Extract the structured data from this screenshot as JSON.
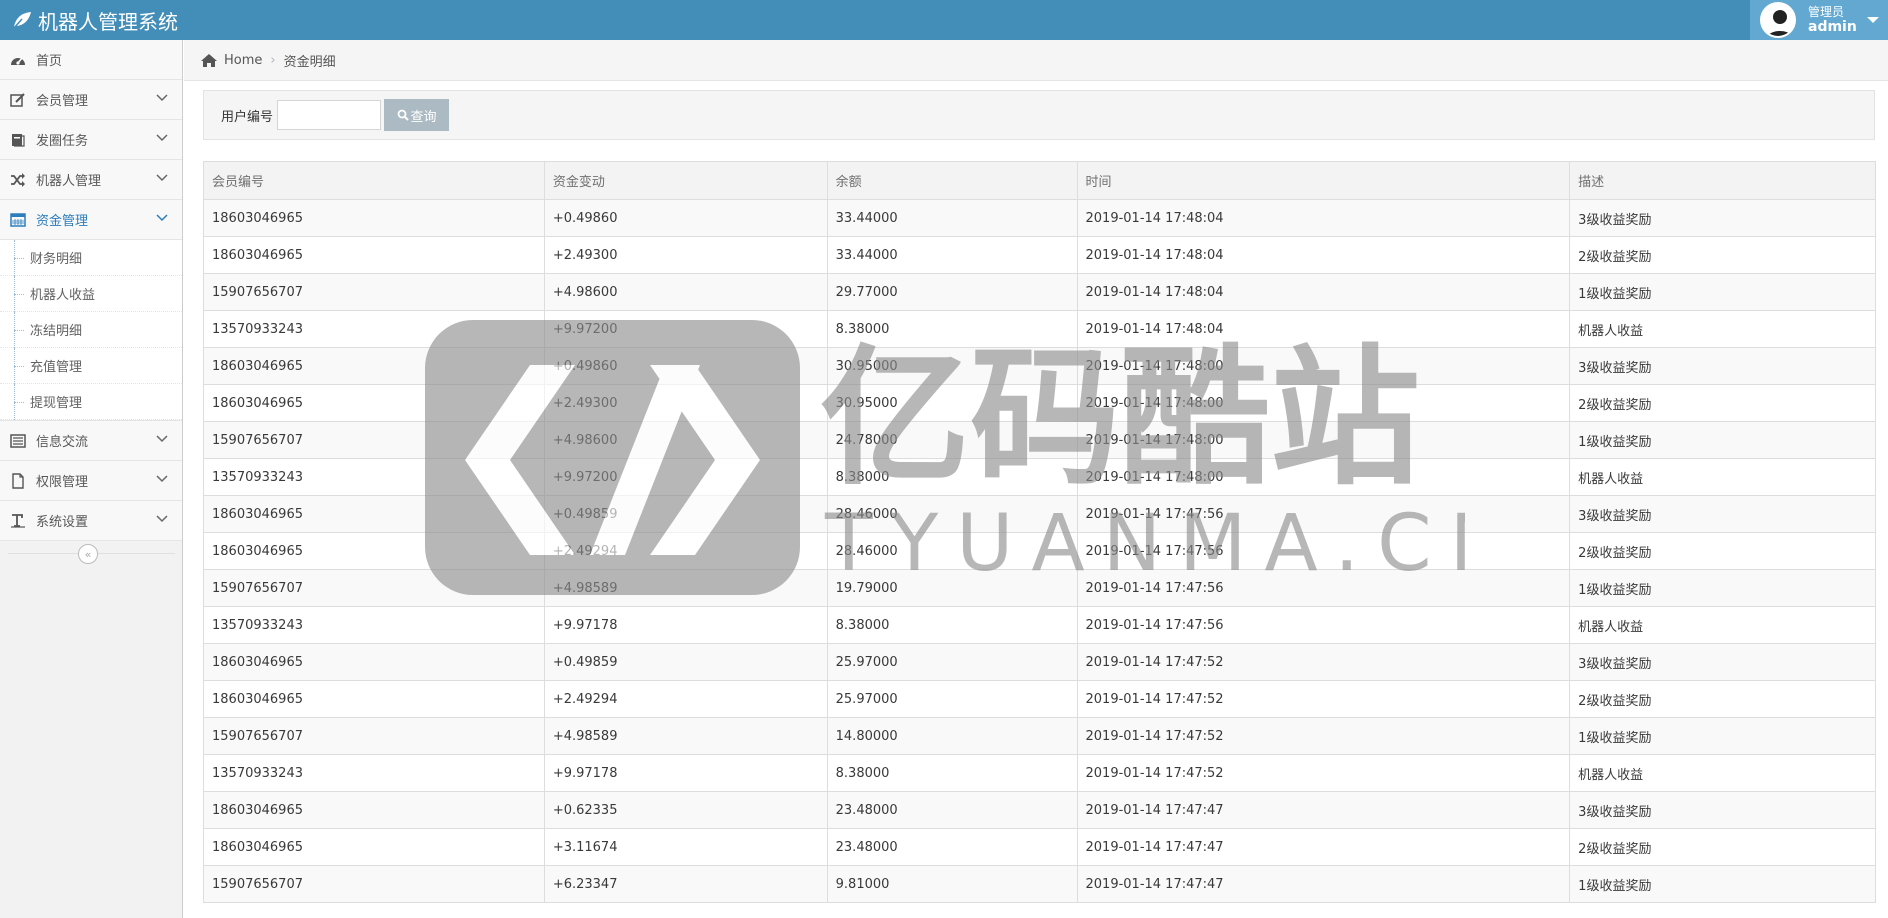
{
  "navbar": {
    "title": "机器人管理系统",
    "user_role": "管理员",
    "user_name": "admin"
  },
  "sidebar": {
    "items": [
      {
        "label": "首页",
        "icon": "dashboard-icon"
      },
      {
        "label": "会员管理",
        "icon": "edit-icon"
      },
      {
        "label": "发圈任务",
        "icon": "book-icon"
      },
      {
        "label": "机器人管理",
        "icon": "shuffle-icon"
      },
      {
        "label": "资金管理",
        "icon": "calendar-icon"
      },
      {
        "label": "信息交流",
        "icon": "list-icon"
      },
      {
        "label": "权限管理",
        "icon": "file-icon"
      },
      {
        "label": "系统设置",
        "icon": "text-icon"
      }
    ],
    "sub_items": [
      "财务明细",
      "机器人收益",
      "冻结明细",
      "充值管理",
      "提现管理"
    ]
  },
  "breadcrumb": {
    "home": "Home",
    "current": "资金明细"
  },
  "search": {
    "label": "用户编号",
    "button": "查询"
  },
  "table": {
    "headers": [
      "会员编号",
      "资金变动",
      "余额",
      "时间",
      "描述"
    ],
    "rows": [
      [
        "18603046965",
        "+0.49860",
        "33.44000",
        "2019-01-14 17:48:04",
        "3级收益奖励"
      ],
      [
        "18603046965",
        "+2.49300",
        "33.44000",
        "2019-01-14 17:48:04",
        "2级收益奖励"
      ],
      [
        "15907656707",
        "+4.98600",
        "29.77000",
        "2019-01-14 17:48:04",
        "1级收益奖励"
      ],
      [
        "13570933243",
        "+9.97200",
        "8.38000",
        "2019-01-14 17:48:04",
        "机器人收益"
      ],
      [
        "18603046965",
        "+0.49860",
        "30.95000",
        "2019-01-14 17:48:00",
        "3级收益奖励"
      ],
      [
        "18603046965",
        "+2.49300",
        "30.95000",
        "2019-01-14 17:48:00",
        "2级收益奖励"
      ],
      [
        "15907656707",
        "+4.98600",
        "24.78000",
        "2019-01-14 17:48:00",
        "1级收益奖励"
      ],
      [
        "13570933243",
        "+9.97200",
        "8.38000",
        "2019-01-14 17:48:00",
        "机器人收益"
      ],
      [
        "18603046965",
        "+0.49859",
        "28.46000",
        "2019-01-14 17:47:56",
        "3级收益奖励"
      ],
      [
        "18603046965",
        "+2.49294",
        "28.46000",
        "2019-01-14 17:47:56",
        "2级收益奖励"
      ],
      [
        "15907656707",
        "+4.98589",
        "19.79000",
        "2019-01-14 17:47:56",
        "1级收益奖励"
      ],
      [
        "13570933243",
        "+9.97178",
        "8.38000",
        "2019-01-14 17:47:56",
        "机器人收益"
      ],
      [
        "18603046965",
        "+0.49859",
        "25.97000",
        "2019-01-14 17:47:52",
        "3级收益奖励"
      ],
      [
        "18603046965",
        "+2.49294",
        "25.97000",
        "2019-01-14 17:47:52",
        "2级收益奖励"
      ],
      [
        "15907656707",
        "+4.98589",
        "14.80000",
        "2019-01-14 17:47:52",
        "1级收益奖励"
      ],
      [
        "13570933243",
        "+9.97178",
        "8.38000",
        "2019-01-14 17:47:52",
        "机器人收益"
      ],
      [
        "18603046965",
        "+0.62335",
        "23.48000",
        "2019-01-14 17:47:47",
        "3级收益奖励"
      ],
      [
        "18603046965",
        "+3.11674",
        "23.48000",
        "2019-01-14 17:47:47",
        "2级收益奖励"
      ],
      [
        "15907656707",
        "+6.23347",
        "9.81000",
        "2019-01-14 17:47:47",
        "1级收益奖励"
      ]
    ]
  },
  "watermark": {
    "cn": "亿码酷站",
    "en": "TYUANMA.CN"
  }
}
